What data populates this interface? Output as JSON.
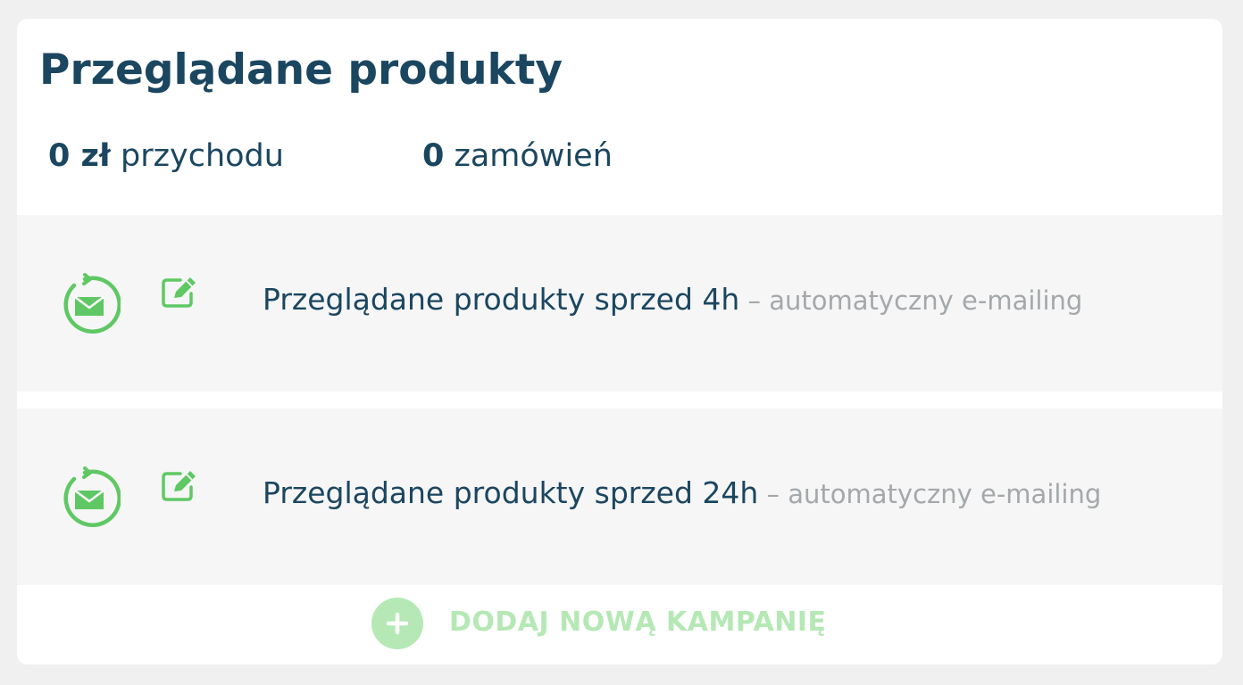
{
  "panel": {
    "title": "Przeglądane produkty"
  },
  "stats": {
    "revenue_value": "0 zł",
    "revenue_label": " przychodu",
    "orders_value": "0",
    "orders_label": " zamówień"
  },
  "campaigns": [
    {
      "name": "Przeglądane produkty sprzed 4h",
      "type": " – automatyczny e-mailing",
      "status_icon": "email-automation-icon",
      "edit_icon": "edit-icon"
    },
    {
      "name": "Przeglądane produkty sprzed 24h",
      "type": " – automatyczny e-mailing",
      "status_icon": "email-automation-icon",
      "edit_icon": "edit-icon"
    }
  ],
  "add_campaign": {
    "label": "DODAJ NOWĄ KAMPANIĘ",
    "icon": "plus-icon"
  },
  "colors": {
    "heading": "#1b4660",
    "accent_green": "#5fc864",
    "muted_green": "#b5e8b5",
    "muted_text": "#a4a8ab",
    "row_background": "#f6f6f6"
  }
}
